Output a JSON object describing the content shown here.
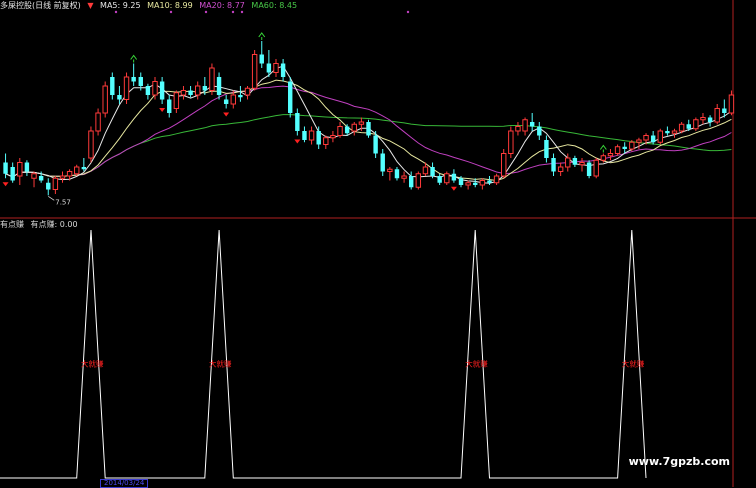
{
  "colors": {
    "background": "#000000",
    "up": "#ff3a3a",
    "down": "#54ffff",
    "ma5": "#e8e8e8",
    "ma10": "#e8e8a0",
    "ma20": "#c040c0",
    "ma60": "#38b838",
    "indicator": "#ffffff",
    "signal": "#ff2020",
    "divider": "#b02020"
  },
  "header": {
    "title": "多屎控股(日线 前复权)",
    "ma5": "MA5: 9.25",
    "ma10": "MA10: 8.99",
    "ma20": "MA20: 8.77",
    "ma60": "MA60: 8.45"
  },
  "indicator_header": {
    "name": "有点赚",
    "value_text": "有点赚: 0.00"
  },
  "low_label": "7.57",
  "watermark": "www.7gpzb.com",
  "date_label": "2014/03/24",
  "chart_data": [
    {
      "type": "candlestick",
      "title": "多屎控股(日线 前复权)",
      "ohlc_note": "open, high, low, close per day (approximate, price units)",
      "ylim": [
        7.2,
        11.6
      ],
      "candles": [
        [
          8.3,
          8.5,
          7.95,
          8.05
        ],
        [
          8.2,
          8.3,
          7.85,
          7.9
        ],
        [
          8.0,
          8.4,
          7.8,
          8.3
        ],
        [
          8.3,
          8.35,
          8.0,
          8.1
        ],
        [
          7.95,
          8.1,
          7.75,
          8.05
        ],
        [
          8.0,
          8.1,
          7.85,
          7.9
        ],
        [
          7.85,
          7.95,
          7.57,
          7.7
        ],
        [
          7.7,
          8.0,
          7.6,
          7.95
        ],
        [
          7.95,
          8.1,
          7.85,
          8.0
        ],
        [
          8.0,
          8.15,
          7.9,
          8.1
        ],
        [
          8.05,
          8.25,
          8.0,
          8.2
        ],
        [
          8.2,
          8.4,
          8.1,
          8.15
        ],
        [
          8.4,
          9.1,
          8.3,
          9.0
        ],
        [
          9.0,
          9.5,
          8.9,
          9.4
        ],
        [
          9.4,
          10.1,
          9.3,
          10.0
        ],
        [
          10.2,
          10.3,
          9.7,
          9.8
        ],
        [
          9.8,
          10.0,
          9.6,
          9.7
        ],
        [
          9.7,
          10.3,
          9.6,
          10.2
        ],
        [
          10.2,
          10.5,
          10.0,
          10.1
        ],
        [
          10.2,
          10.3,
          9.9,
          10.0
        ],
        [
          10.0,
          10.05,
          9.7,
          9.8
        ],
        [
          9.8,
          10.2,
          9.7,
          10.1
        ],
        [
          10.1,
          10.2,
          9.6,
          9.7
        ],
        [
          9.7,
          9.8,
          9.3,
          9.4
        ],
        [
          9.5,
          9.9,
          9.4,
          9.85
        ],
        [
          9.8,
          10.0,
          9.7,
          9.9
        ],
        [
          9.9,
          10.0,
          9.75,
          9.8
        ],
        [
          9.8,
          10.1,
          9.7,
          10.0
        ],
        [
          10.0,
          10.2,
          9.8,
          9.9
        ],
        [
          9.9,
          10.5,
          9.8,
          10.4
        ],
        [
          10.2,
          10.3,
          9.7,
          9.8
        ],
        [
          9.7,
          9.8,
          9.5,
          9.6
        ],
        [
          9.6,
          9.9,
          9.5,
          9.8
        ],
        [
          9.8,
          10.0,
          9.65,
          9.75
        ],
        [
          9.8,
          10.0,
          9.7,
          9.95
        ],
        [
          9.95,
          10.8,
          9.9,
          10.7
        ],
        [
          10.7,
          11.0,
          10.4,
          10.5
        ],
        [
          10.5,
          10.8,
          10.2,
          10.3
        ],
        [
          10.3,
          10.6,
          10.2,
          10.5
        ],
        [
          10.5,
          10.6,
          10.1,
          10.2
        ],
        [
          10.1,
          10.2,
          9.3,
          9.4
        ],
        [
          9.4,
          9.5,
          8.9,
          9.0
        ],
        [
          9.0,
          9.1,
          8.75,
          8.8
        ],
        [
          8.8,
          9.1,
          8.7,
          9.0
        ],
        [
          9.0,
          9.1,
          8.6,
          8.7
        ],
        [
          8.7,
          8.9,
          8.6,
          8.85
        ],
        [
          8.85,
          9.0,
          8.75,
          8.9
        ],
        [
          8.9,
          9.2,
          8.85,
          9.1
        ],
        [
          9.1,
          9.15,
          8.9,
          8.95
        ],
        [
          9.0,
          9.2,
          8.9,
          9.15
        ],
        [
          9.15,
          9.3,
          9.0,
          9.2
        ],
        [
          9.2,
          9.25,
          8.85,
          8.9
        ],
        [
          8.9,
          9.0,
          8.4,
          8.5
        ],
        [
          8.5,
          8.6,
          8.0,
          8.1
        ],
        [
          8.1,
          8.2,
          7.9,
          8.15
        ],
        [
          8.15,
          8.2,
          7.9,
          7.95
        ],
        [
          7.95,
          8.1,
          7.85,
          8.0
        ],
        [
          8.0,
          8.1,
          7.7,
          7.75
        ],
        [
          7.75,
          8.1,
          7.7,
          8.05
        ],
        [
          8.05,
          8.3,
          8.0,
          8.2
        ],
        [
          8.2,
          8.3,
          7.95,
          8.0
        ],
        [
          8.0,
          8.05,
          7.8,
          7.85
        ],
        [
          7.85,
          8.1,
          7.8,
          8.05
        ],
        [
          8.05,
          8.15,
          7.85,
          7.9
        ],
        [
          7.95,
          8.0,
          7.75,
          7.8
        ],
        [
          7.8,
          7.9,
          7.7,
          7.85
        ],
        [
          7.85,
          7.95,
          7.75,
          7.8
        ],
        [
          7.8,
          7.95,
          7.7,
          7.9
        ],
        [
          7.9,
          8.0,
          7.8,
          7.85
        ],
        [
          7.85,
          8.05,
          7.8,
          8.0
        ],
        [
          8.0,
          8.6,
          7.95,
          8.5
        ],
        [
          8.5,
          9.1,
          8.4,
          9.0
        ],
        [
          9.0,
          9.2,
          8.9,
          9.1
        ],
        [
          9.0,
          9.3,
          8.9,
          9.25
        ],
        [
          9.2,
          9.4,
          9.0,
          9.1
        ],
        [
          9.1,
          9.2,
          8.8,
          8.9
        ],
        [
          8.8,
          8.9,
          8.3,
          8.4
        ],
        [
          8.4,
          8.5,
          8.0,
          8.1
        ],
        [
          8.1,
          8.3,
          8.0,
          8.2
        ],
        [
          8.2,
          8.5,
          8.1,
          8.4
        ],
        [
          8.4,
          8.45,
          8.2,
          8.25
        ],
        [
          8.25,
          8.4,
          8.1,
          8.3
        ],
        [
          8.3,
          8.35,
          7.95,
          8.0
        ],
        [
          8.0,
          8.4,
          7.95,
          8.35
        ],
        [
          8.35,
          8.5,
          8.3,
          8.45
        ],
        [
          8.45,
          8.6,
          8.35,
          8.5
        ],
        [
          8.5,
          8.7,
          8.45,
          8.65
        ],
        [
          8.65,
          8.75,
          8.5,
          8.6
        ],
        [
          8.6,
          8.8,
          8.55,
          8.75
        ],
        [
          8.75,
          8.85,
          8.6,
          8.8
        ],
        [
          8.8,
          8.95,
          8.7,
          8.9
        ],
        [
          8.9,
          9.0,
          8.7,
          8.75
        ],
        [
          8.75,
          9.05,
          8.7,
          9.0
        ],
        [
          9.0,
          9.1,
          8.9,
          8.95
        ],
        [
          8.95,
          9.05,
          8.85,
          9.0
        ],
        [
          9.0,
          9.2,
          8.95,
          9.15
        ],
        [
          9.15,
          9.25,
          9.0,
          9.05
        ],
        [
          9.05,
          9.3,
          9.0,
          9.25
        ],
        [
          9.25,
          9.4,
          9.15,
          9.3
        ],
        [
          9.3,
          9.35,
          9.1,
          9.2
        ],
        [
          9.2,
          9.6,
          9.15,
          9.5
        ],
        [
          9.5,
          9.7,
          9.3,
          9.4
        ],
        [
          9.4,
          9.9,
          9.35,
          9.8
        ]
      ],
      "series": [
        {
          "name": "MA5",
          "last": 9.25
        },
        {
          "name": "MA10",
          "last": 8.99
        },
        {
          "name": "MA20",
          "last": 8.77
        },
        {
          "name": "MA60",
          "last": 8.45
        }
      ],
      "annotations": [
        "7.57"
      ]
    },
    {
      "type": "line",
      "title": "有点赚",
      "ylim": [
        0,
        1
      ],
      "series": [
        {
          "name": "有点赚",
          "spikes_at_candle_index": [
            12,
            30,
            66,
            88
          ],
          "current": 0.0
        }
      ],
      "spike_label": "大就赚"
    }
  ]
}
